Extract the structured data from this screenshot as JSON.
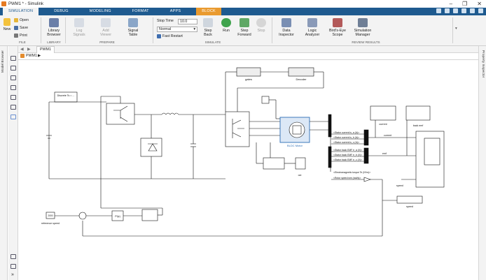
{
  "window": {
    "title": "PWM1 * - Simulink",
    "controls": [
      "–",
      "❐",
      "✕"
    ]
  },
  "tabs": [
    "SIMULATION",
    "DEBUG",
    "MODELING",
    "FORMAT",
    "APPS",
    "BLOCK"
  ],
  "ribbon": {
    "file": {
      "new": "New",
      "open": "Open",
      "save": "Save",
      "print": "Print",
      "section": "FILE"
    },
    "library": {
      "browser": "Library\nBrowser",
      "section": "LIBRARY"
    },
    "prepare": {
      "log_signals": "Log\nSignals",
      "add_viewer": "Add\nViewer",
      "signal_table": "Signal\nTable",
      "section": "PREPARE"
    },
    "simulate": {
      "stop_time_label": "Stop Time",
      "stop_time_value": "10.0",
      "mode": "Normal",
      "fast_restart": "Fast Restart",
      "step_back": "Step\nBack",
      "run": "Run",
      "step_forward": "Step\nForward",
      "stop": "Stop",
      "section": "SIMULATE"
    },
    "review": {
      "data_inspector": "Data\nInspector",
      "logic_analyzer": "Logic\nAnalyzer",
      "birds_eye": "Bird's-Eye\nScope",
      "sim_manager": "Simulation\nManager",
      "section": "REVIEW RESULTS"
    }
  },
  "side": {
    "model_browser": "Model Browser",
    "property_inspector": "Property Inspector"
  },
  "canvas": {
    "tab": "PWM1",
    "breadcrumb": "PWM1",
    "blocks": {
      "discrete": "Discrete\nTs = ...",
      "gates": "gates",
      "decoder": "Decoder",
      "bldc_motor": "BLDC Motor",
      "current": "current",
      "back_emf": "back emf",
      "emf": "emf",
      "speed": "speed",
      "speed2": "speed",
      "ref_speed": "reference speed",
      "pi": "PI(z)",
      "ref_value": "2000",
      "out": "out",
      "sig1": "<Stator current is_a (A)>",
      "sig2": "<Stator current is_b (A)>",
      "sig3": "<Stator current is_c (A)>",
      "sig4": "<Stator back EMF e_a (V)>",
      "sig5": "<Stator back EMF e_b (V)>",
      "sig6": "<Stator back EMF e_c (V)>",
      "sig7": "<Electromagnetic torque Te (N*m)>",
      "sig8": "<Rotor speed wm (rad/s)>"
    }
  }
}
